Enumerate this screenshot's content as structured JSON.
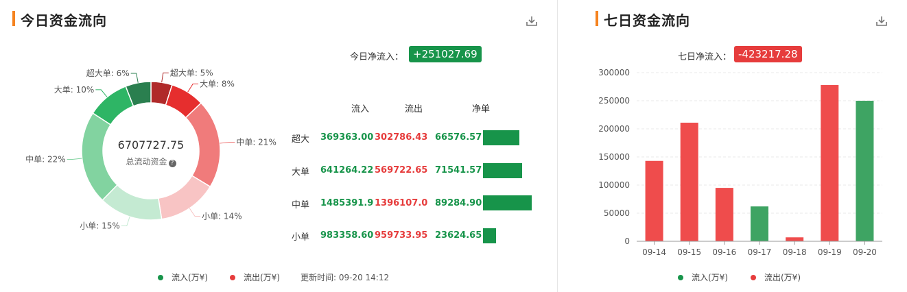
{
  "colors": {
    "accent": "#f5831f",
    "inflow_green": "#17944a",
    "outflow_red": "#e63c3c"
  },
  "today": {
    "title": "今日资金流向",
    "download_icon": "download-icon",
    "net_label": "今日净流入：",
    "net_value": "+251027.69",
    "center_total": "6707727.75",
    "center_caption": "总流动资金",
    "info_icon": "question-circle-icon",
    "table_headers": {
      "in": "流入",
      "out": "流出",
      "net": "净单"
    },
    "rows": [
      {
        "label": "超大",
        "in": "369363.00",
        "out": "302786.43",
        "net": "66576.57"
      },
      {
        "label": "大单",
        "in": "641264.22",
        "out": "569722.65",
        "net": "71541.57"
      },
      {
        "label": "中单",
        "in": "1485391.9",
        "out": "1396107.0",
        "net": "89284.90"
      },
      {
        "label": "小单",
        "in": "983358.60",
        "out": "959733.95",
        "net": "23624.65"
      }
    ],
    "legend": {
      "in": "流入(万¥)",
      "out": "流出(万¥)"
    },
    "update_time": "更新时间: 09-20 14:12"
  },
  "week": {
    "title": "七日资金流向",
    "download_icon": "download-icon",
    "net_label": "七日净流入：",
    "net_value": "-423217.28",
    "legend": {
      "in": "流入(万¥)",
      "out": "流出(万¥)"
    }
  },
  "chart_data": [
    {
      "type": "pie",
      "title": "",
      "labels": [
        "超大单",
        "大单",
        "中单",
        "小单",
        "小单",
        "中单",
        "大单",
        "超大单"
      ],
      "label_texts": [
        "超大单: 5%",
        "大单: 8%",
        "中单: 21%",
        "小单: 14%",
        "小单: 15%",
        "中单: 22%",
        "大单: 10%",
        "超大单: 6%"
      ],
      "values": [
        5,
        8,
        21,
        14,
        15,
        22,
        10,
        6
      ],
      "flow": [
        "out",
        "out",
        "out",
        "out",
        "in",
        "in",
        "in",
        "in"
      ],
      "colors": [
        "#b02a2a",
        "#e62e2e",
        "#f07b7b",
        "#f8c4c4",
        "#c4ead2",
        "#82d3a0",
        "#2eb565",
        "#2a7f4f"
      ],
      "donut": true
    },
    {
      "type": "bar",
      "title": "",
      "categories": [
        "09-14",
        "09-15",
        "09-16",
        "09-17",
        "09-18",
        "09-19",
        "09-20"
      ],
      "values": [
        143000,
        211000,
        95000,
        62000,
        7000,
        278000,
        250000
      ],
      "direction": [
        "out",
        "out",
        "out",
        "in",
        "out",
        "out",
        "in"
      ],
      "colors": {
        "in": "#3ea463",
        "out": "#ef4c4c"
      },
      "ylim": [
        0,
        300000
      ],
      "yticks": [
        "0",
        "50000",
        "100000",
        "150000",
        "200000",
        "250000",
        "300000"
      ],
      "xlabel": "",
      "ylabel": "",
      "grid": true
    }
  ]
}
